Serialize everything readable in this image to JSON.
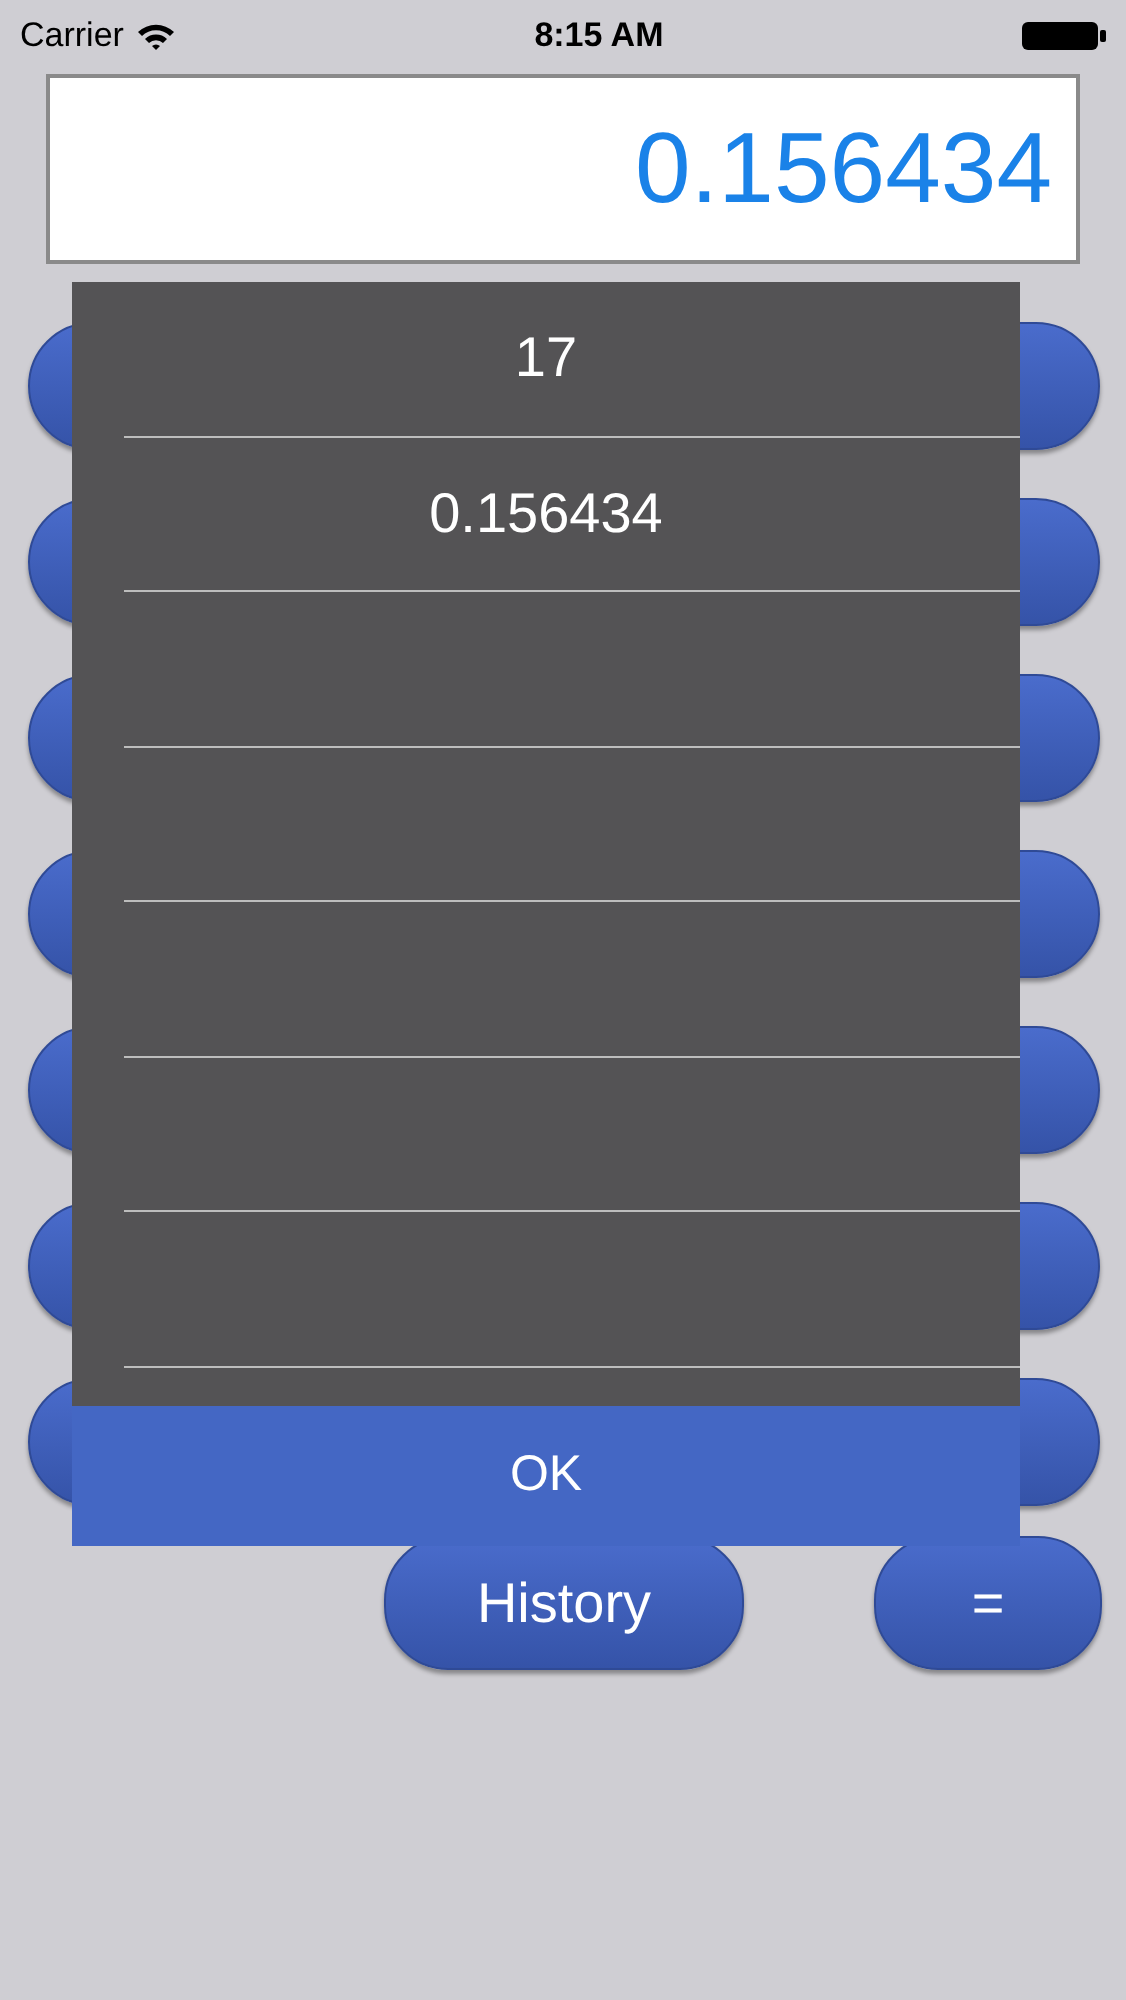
{
  "status_bar": {
    "carrier": "Carrier",
    "time": "8:15 AM"
  },
  "display": {
    "value": "0.156434"
  },
  "history_popup": {
    "entries": [
      "17",
      "0.156434"
    ],
    "ok_button": "OK"
  },
  "bottom_row": {
    "history_button": "History",
    "equals_button": "="
  }
}
